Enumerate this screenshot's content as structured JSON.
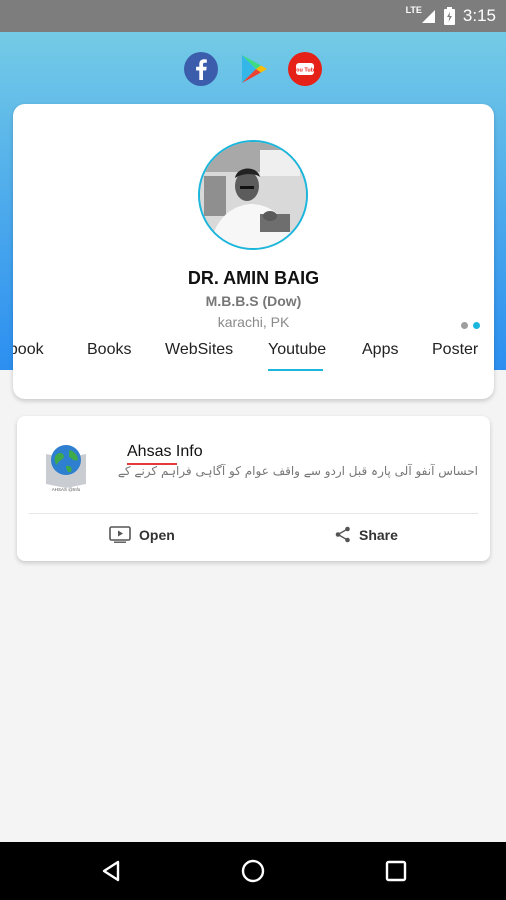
{
  "status_bar": {
    "network": "LTE",
    "time": "3:15"
  },
  "social_icons": [
    "facebook-icon",
    "play-store-icon",
    "youtube-icon"
  ],
  "youtube_logo_text": "You Tube",
  "profile": {
    "name": "DR. AMIN BAIG",
    "degree": "M.B.B.S (Dow)",
    "location": "karachi, PK"
  },
  "tabs": [
    {
      "label": "ebook",
      "active": false
    },
    {
      "label": "Books",
      "active": false
    },
    {
      "label": "WebSites",
      "active": false
    },
    {
      "label": "Youtube",
      "active": true
    },
    {
      "label": "Apps",
      "active": false
    },
    {
      "label": "Poster",
      "active": false
    }
  ],
  "app_item": {
    "title": "Ahsas Info",
    "description": "احساس آنفو آلی پارہ قبل اردو سے واقف عوام کو آگاہی فراہم کرنے کے",
    "logo_caption": "AHSAS @Info",
    "open_label": "Open",
    "share_label": "Share"
  },
  "colors": {
    "accent": "#1bb6dc",
    "header_top": "#74cbe6",
    "header_bottom": "#2c8ff0",
    "dot_inactive": "#9e9e9e",
    "title_underline": "#e23b3b"
  },
  "nav_icons": [
    "back-icon",
    "home-icon",
    "recents-icon"
  ]
}
